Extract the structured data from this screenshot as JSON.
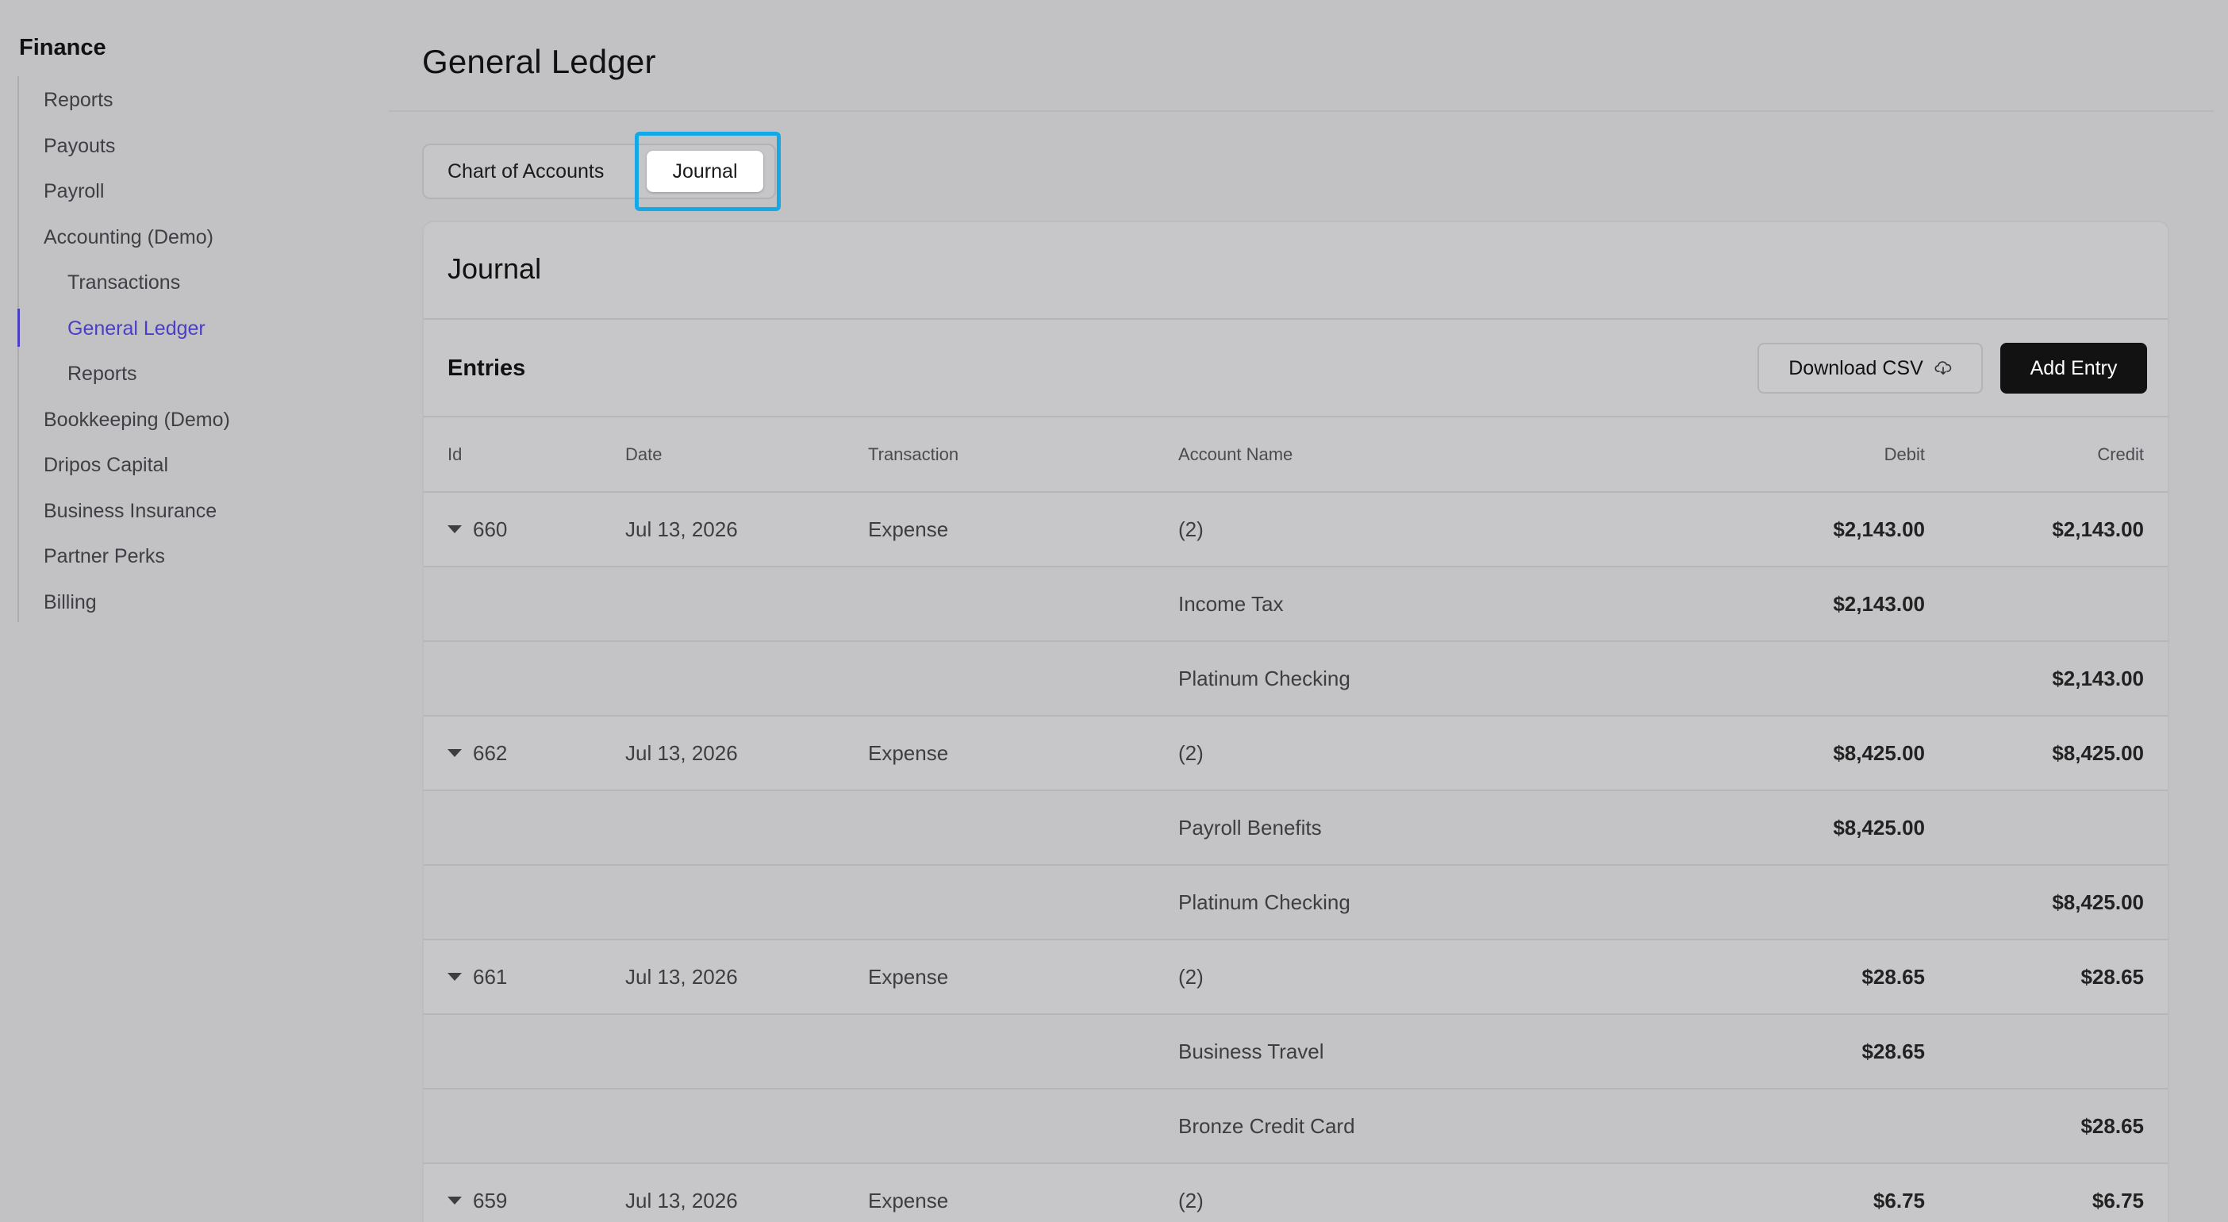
{
  "sidebar": {
    "title": "Finance",
    "items": [
      {
        "label": "Reports"
      },
      {
        "label": "Payouts"
      },
      {
        "label": "Payroll"
      },
      {
        "label": "Accounting (Demo)"
      },
      {
        "label": "Transactions"
      },
      {
        "label": "General Ledger"
      },
      {
        "label": "Reports"
      },
      {
        "label": "Bookkeeping (Demo)"
      },
      {
        "label": "Dripos Capital"
      },
      {
        "label": "Business Insurance"
      },
      {
        "label": "Partner Perks"
      },
      {
        "label": "Billing"
      }
    ],
    "active_item": "General Ledger",
    "accent_color": "#4a3fc2"
  },
  "header": {
    "title": "General Ledger"
  },
  "tabs": [
    {
      "label": "Chart of Accounts"
    },
    {
      "label": "Journal",
      "selected": true
    }
  ],
  "card": {
    "title": "Journal",
    "section_label": "Entries",
    "download_label": "Download CSV",
    "download_icon": "cloud-download-icon",
    "add_label": "Add Entry"
  },
  "table": {
    "headers": {
      "id": "Id",
      "date": "Date",
      "transaction": "Transaction",
      "account": "Account Name",
      "debit": "Debit",
      "credit": "Credit"
    },
    "rows": [
      {
        "id": "660",
        "date": "Jul 13, 2026",
        "transaction": "Expense",
        "account": "(2)",
        "debit": "$2,143.00",
        "credit": "$2,143.00"
      },
      {
        "account": "Income Tax",
        "debit": "$2,143.00",
        "credit": ""
      },
      {
        "account": "Platinum Checking",
        "debit": "",
        "credit": "$2,143.00"
      },
      {
        "id": "662",
        "date": "Jul 13, 2026",
        "transaction": "Expense",
        "account": "(2)",
        "debit": "$8,425.00",
        "credit": "$8,425.00"
      },
      {
        "account": "Payroll Benefits",
        "debit": "$8,425.00",
        "credit": ""
      },
      {
        "account": "Platinum Checking",
        "debit": "",
        "credit": "$8,425.00"
      },
      {
        "id": "661",
        "date": "Jul 13, 2026",
        "transaction": "Expense",
        "account": "(2)",
        "debit": "$28.65",
        "credit": "$28.65"
      },
      {
        "account": "Business Travel",
        "debit": "$28.65",
        "credit": ""
      },
      {
        "account": "Bronze Credit Card",
        "debit": "",
        "credit": "$28.65"
      },
      {
        "id": "659",
        "date": "Jul 13, 2026",
        "transaction": "Expense",
        "account": "(2)",
        "debit": "$6.75",
        "credit": "$6.75"
      }
    ]
  },
  "highlight_color": "#14a8e6"
}
